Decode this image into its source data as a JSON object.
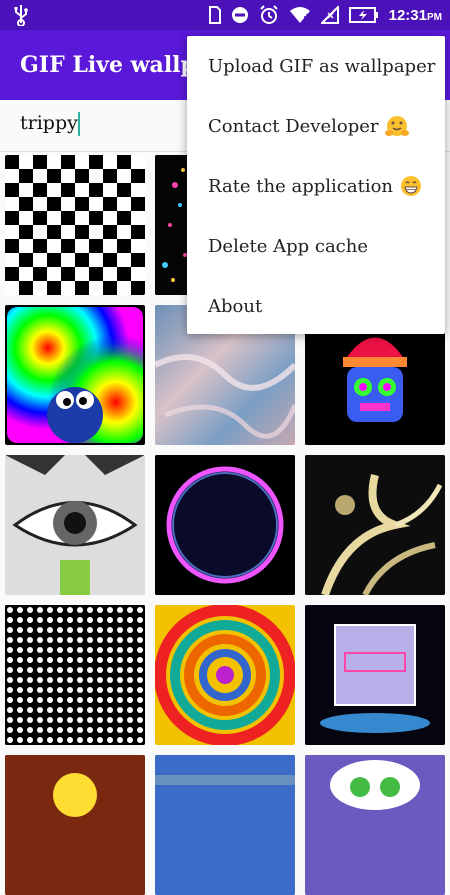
{
  "status_bar": {
    "time": "12:31",
    "ampm": "PM",
    "icons": [
      "usb-icon",
      "sim-icon",
      "do-not-disturb-icon",
      "alarm-icon",
      "wifi-icon",
      "signal-icon",
      "battery-charging-icon"
    ]
  },
  "app_bar": {
    "title": "GIF Live wallpaper"
  },
  "search": {
    "value": "trippy"
  },
  "menu": {
    "items": [
      {
        "label": "Upload GIF as wallpaper",
        "emoji": ""
      },
      {
        "label": "Contact Developer",
        "emoji": "hugging-face-emoji"
      },
      {
        "label": "Rate the application",
        "emoji": "grinning-face-emoji"
      },
      {
        "label": "Delete App cache",
        "emoji": ""
      },
      {
        "label": "About",
        "emoji": ""
      }
    ]
  },
  "gallery": {
    "tiles": [
      {
        "icon": "checkerboard-gif-thumbnail"
      },
      {
        "icon": "neon-particles-gif-thumbnail"
      },
      {
        "icon": "gif-thumbnail"
      },
      {
        "icon": "rainbow-fractal-cookie-monster-gif-thumbnail"
      },
      {
        "icon": "marble-clouds-gif-thumbnail"
      },
      {
        "icon": "colorful-character-gif-thumbnail"
      },
      {
        "icon": "psychedelic-eye-gif-thumbnail"
      },
      {
        "icon": "glowing-circle-gif-thumbnail"
      },
      {
        "icon": "golden-fractal-gif-thumbnail"
      },
      {
        "icon": "dot-grid-illusion-gif-thumbnail"
      },
      {
        "icon": "rainbow-spiral-gif-thumbnail"
      },
      {
        "icon": "neon-box-gif-thumbnail"
      },
      {
        "icon": "cartoon-character-gif-thumbnail"
      },
      {
        "icon": "blue-noise-gif-thumbnail"
      },
      {
        "icon": "mario-character-gif-thumbnail"
      }
    ]
  },
  "colors": {
    "status_bar": "#4a12b8",
    "app_bar": "#5a18d8",
    "accent": "#2bb3a0"
  }
}
